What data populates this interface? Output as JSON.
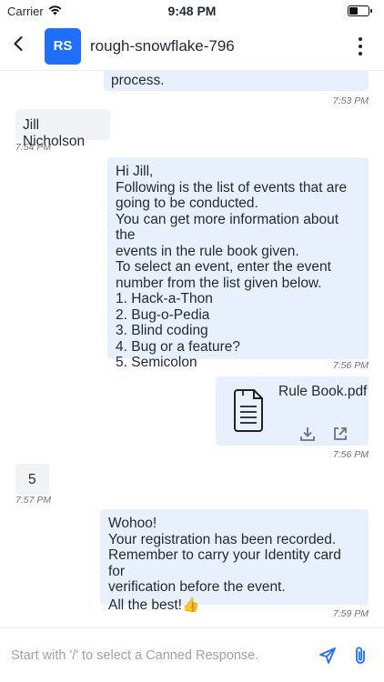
{
  "status_bar": {
    "carrier": "Carrier",
    "time": "9:48 PM",
    "battery_level": 0.45
  },
  "header": {
    "avatar_initials": "RS",
    "contact_name": "rough-snowflake-796",
    "accent": "#1f6fff"
  },
  "messages": [
    {
      "direction": "outgoing",
      "text": "process.",
      "time": "7:53 PM"
    },
    {
      "direction": "incoming",
      "text": "Jill Nicholson",
      "time": "7:54 PM"
    },
    {
      "direction": "outgoing",
      "text": "Hi Jill,\nFollowing is the list of events that are\ngoing to be conducted.\nYou can get more information about the\nevents in the rule book given.\nTo select an event, enter the event\nnumber from the list given below.\n1. Hack-a-Thon\n2. Bug-o-Pedia\n3. Blind coding\n4. Bug or a feature?\n5. Semicolon",
      "time": "7:56 PM"
    },
    {
      "direction": "outgoing",
      "type": "attachment",
      "file_name": "Rule Book.pdf",
      "time": "7:56 PM"
    },
    {
      "direction": "incoming",
      "text": "5",
      "time": "7:57 PM"
    },
    {
      "direction": "outgoing",
      "text": "Wohoo!\nYour registration has been recorded.\nRemember to carry your Identity card for\nverification before the event.",
      "text2": "All the best!",
      "emoji": "👍",
      "time": "7:59 PM"
    }
  ],
  "composer": {
    "placeholder": "Start with '/' to select a Canned Response."
  }
}
